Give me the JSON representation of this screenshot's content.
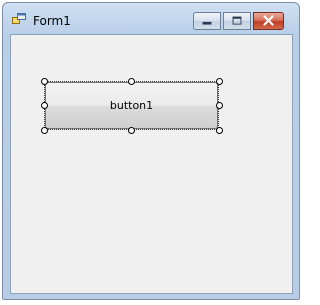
{
  "window": {
    "title": "Form1",
    "icons": {
      "app": "form-app-icon",
      "minimize": "minimize-icon",
      "maximize": "maximize-icon",
      "close": "close-icon"
    }
  },
  "form": {
    "button1_label": "button1"
  },
  "colors": {
    "client_background": "#f0f0f0",
    "close_button": "#c13d23",
    "titlebar": "#b9cfe8"
  }
}
